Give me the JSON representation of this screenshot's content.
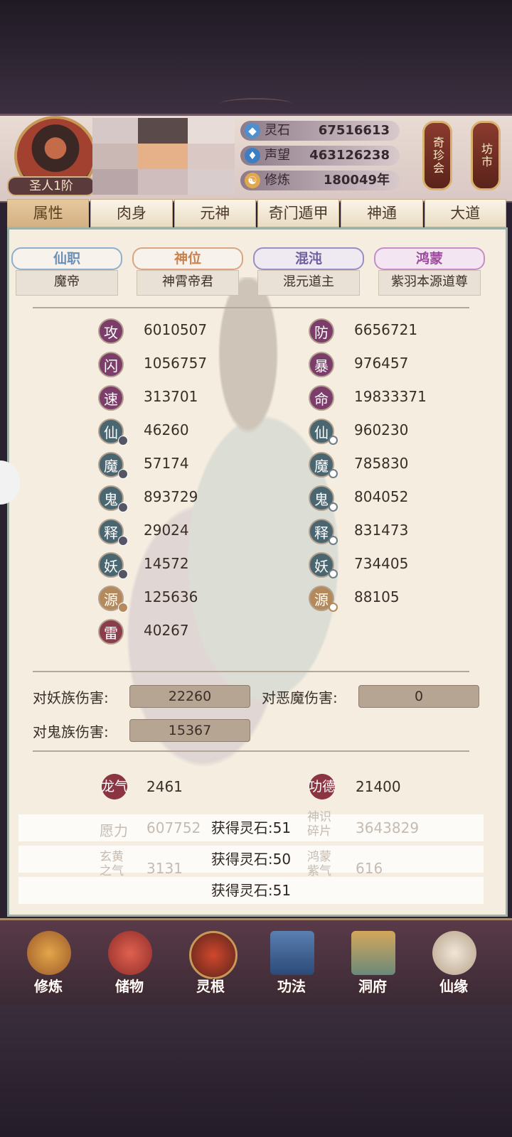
{
  "player": {
    "rank": "圣人1阶"
  },
  "resources": [
    {
      "name": "灵石",
      "value": "67516613",
      "icon": "spirit-stone-icon"
    },
    {
      "name": "声望",
      "value": "463126238",
      "icon": "prestige-icon"
    },
    {
      "name": "修炼",
      "value": "180049年",
      "icon": "meditation-icon"
    }
  ],
  "side_buttons": {
    "treasure": "奇珍会",
    "market": "坊市"
  },
  "tabs": [
    "属性",
    "肉身",
    "元神",
    "奇门遁甲",
    "神通",
    "大道"
  ],
  "ranks": [
    {
      "title": "仙职",
      "value": "魔帝",
      "color": "#6c8fb5"
    },
    {
      "title": "神位",
      "value": "神霄帝君",
      "color": "#c9824e"
    },
    {
      "title": "混沌",
      "value": "混元道主",
      "color": "#6d5fa0"
    },
    {
      "title": "鸿蒙",
      "value": "紫羽本源道尊",
      "color": "#9b4d9c"
    }
  ],
  "stats_left": [
    {
      "icon": "攻",
      "value": "6010507"
    },
    {
      "icon": "闪",
      "value": "1056757"
    },
    {
      "icon": "速",
      "value": "313701"
    },
    {
      "icon": "仙",
      "value": "46260"
    },
    {
      "icon": "魔",
      "value": "57174"
    },
    {
      "icon": "鬼",
      "value": "893729"
    },
    {
      "icon": "释",
      "value": "29024"
    },
    {
      "icon": "妖",
      "value": "14572"
    },
    {
      "icon": "源",
      "value": "125636"
    },
    {
      "icon": "雷",
      "value": "40267"
    }
  ],
  "stats_right": [
    {
      "icon": "防",
      "value": "6656721"
    },
    {
      "icon": "暴",
      "value": "976457"
    },
    {
      "icon": "命",
      "value": "19833371"
    },
    {
      "icon": "仙",
      "value": "960230"
    },
    {
      "icon": "魔",
      "value": "785830"
    },
    {
      "icon": "鬼",
      "value": "804052"
    },
    {
      "icon": "释",
      "value": "831473"
    },
    {
      "icon": "妖",
      "value": "734405"
    },
    {
      "icon": "源",
      "value": "88105"
    }
  ],
  "damage": {
    "demon_race_label": "对妖族伤害:",
    "demon_race_value": "22260",
    "evil_label": "对恶魔伤害:",
    "evil_value": "0",
    "ghost_label": "对鬼族伤害:",
    "ghost_value": "15367"
  },
  "bonus": {
    "dragon_label": "龙气",
    "dragon_value": "2461",
    "merit_label": "功德",
    "merit_value": "21400",
    "wish_label": "愿力",
    "wish_value": "607752",
    "shard_label": "神识碎片",
    "shard_value": "3643829",
    "xuanhuang_label": "玄黄之气",
    "xuanhuang_value": "3131",
    "hongmeng_label": "鸿蒙紫气",
    "hongmeng_value": "616"
  },
  "toasts": [
    "获得灵石:51",
    "获得灵石:50",
    "获得灵石:51"
  ],
  "bottom_nav": [
    "修炼",
    "储物",
    "灵根",
    "功法",
    "洞府",
    "仙缘"
  ]
}
